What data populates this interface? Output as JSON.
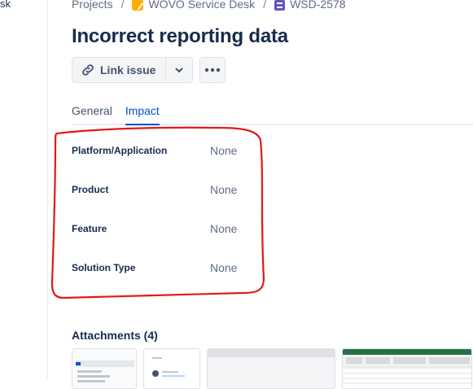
{
  "left_rail": {
    "text": "sk"
  },
  "breadcrumbs": {
    "projects": "Projects",
    "project": "WOVO Service Desk",
    "issue_key": "WSD-2578",
    "separator": "/"
  },
  "issue": {
    "title": "Incorrect reporting data"
  },
  "toolbar": {
    "link_issue_label": "Link issue",
    "dropdown_icon": "chevron-down-icon",
    "more_icon": "more-horizontal-icon"
  },
  "tabs": [
    {
      "label": "General",
      "active": false
    },
    {
      "label": "Impact",
      "active": true
    }
  ],
  "impact_fields": [
    {
      "label": "Platform/Application",
      "value": "None"
    },
    {
      "label": "Product",
      "value": "None"
    },
    {
      "label": "Feature",
      "value": "None"
    },
    {
      "label": "Solution Type",
      "value": "None"
    }
  ],
  "attachments": {
    "title": "Attachments (4)"
  },
  "colors": {
    "accent": "#0052cc",
    "annotation": "#e0191c",
    "text": "#172b4d",
    "muted": "#5e6c84"
  }
}
